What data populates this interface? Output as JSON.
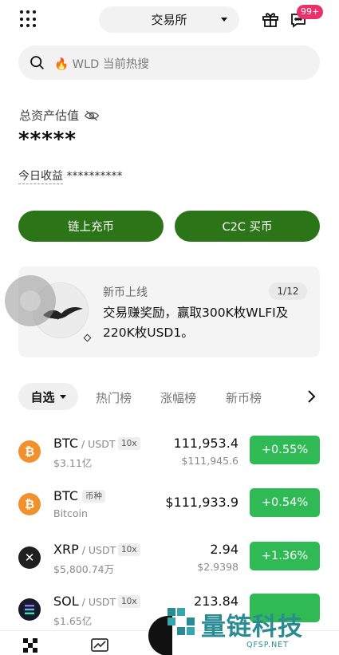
{
  "header": {
    "exchange_label": "交易所",
    "badge": "99+",
    "icons": [
      "menu-grid-icon",
      "gift-icon",
      "message-icon"
    ]
  },
  "search": {
    "placeholder": "🔥 WLD 当前热搜"
  },
  "assets": {
    "label": "总资产估值",
    "value": "*****",
    "today_label": "今日收益",
    "today_value": "**********"
  },
  "actions": {
    "onchain_deposit": "链上充币",
    "c2c_buy": "C2C 买币"
  },
  "banner": {
    "title": "新币上线",
    "count": "1/12",
    "text": "交易赚奖励，赢取300K枚WLFI及220K枚USD1。"
  },
  "tabs": {
    "active": "自选",
    "items": [
      "热门榜",
      "涨幅榜",
      "新币榜"
    ]
  },
  "colors": {
    "primary_green": "#2c7418",
    "up_green": "#2fba55",
    "badge_pink": "#e8336a"
  },
  "market": [
    {
      "symbol": "BTC",
      "quote": " / USDT",
      "tag": "10x",
      "sub": "$3.11亿",
      "price": "111,953.4",
      "price_sub": "$111,945.6",
      "change": "+0.55%",
      "icon": "bitcoin-icon"
    },
    {
      "symbol": "BTC",
      "quote": "",
      "tag": "币种",
      "sub": "Bitcoin",
      "price": "$111,933.9",
      "price_sub": "",
      "change": "+0.54%",
      "icon": "bitcoin-icon"
    },
    {
      "symbol": "XRP",
      "quote": " / USDT",
      "tag": "10x",
      "sub": "$5,800.74万",
      "price": "2.94",
      "price_sub": "$2.9398",
      "change": "+1.36%",
      "icon": "xrp-icon"
    },
    {
      "symbol": "SOL",
      "quote": " / USDT",
      "tag": "10x",
      "sub": "$1.65亿",
      "price": "213.84",
      "price_sub": "",
      "change": "",
      "icon": "solana-icon"
    }
  ],
  "watermark": {
    "text": "量链科技",
    "url": "QFSP.NET"
  }
}
